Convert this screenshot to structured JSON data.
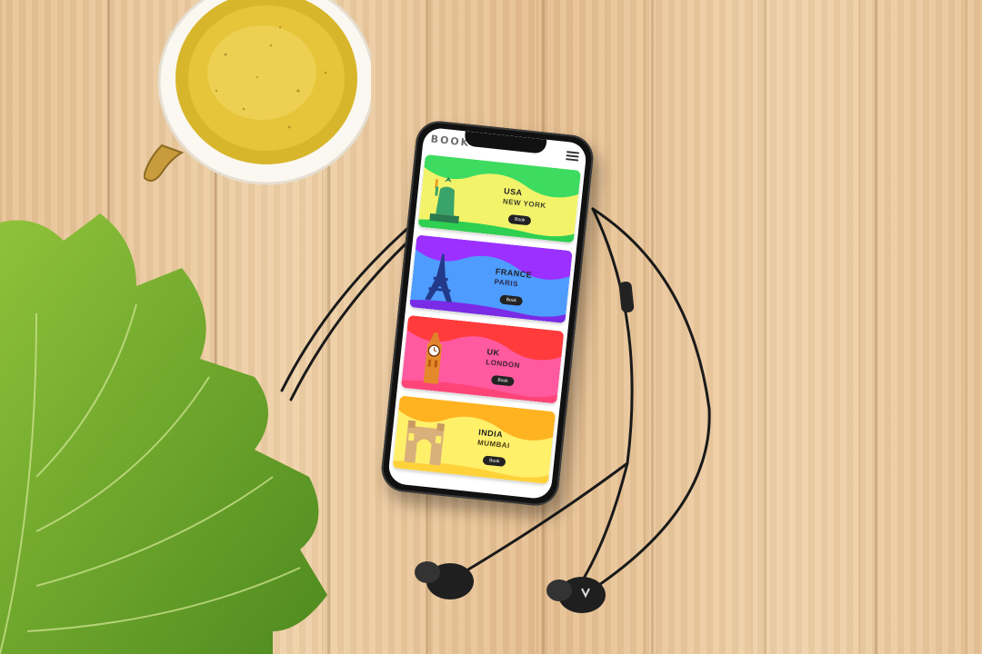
{
  "app": {
    "logo": "BOOK",
    "menu_icon": "hamburger-menu-icon"
  },
  "destinations": [
    {
      "country": "USA",
      "city": "NEW YORK",
      "button": "Book",
      "landmark_icon": "statue-of-liberty-icon",
      "colors": {
        "from": "#f6f05a",
        "to": "#3ddc61",
        "city": "#3f3f2a"
      }
    },
    {
      "country": "FRANCE",
      "city": "PARIS",
      "button": "Book",
      "landmark_icon": "eiffel-tower-icon",
      "colors": {
        "from": "#4aa1ff",
        "to": "#a22cff",
        "city": "#2b2b4a"
      }
    },
    {
      "country": "UK",
      "city": "LONDON",
      "button": "Book",
      "landmark_icon": "big-ben-icon",
      "colors": {
        "from": "#ff4f9a",
        "to": "#ff3a3a",
        "city": "#3a1e2a"
      }
    },
    {
      "country": "INDIA",
      "city": "MUMBAI",
      "button": "Book",
      "landmark_icon": "gateway-of-india-icon",
      "colors": {
        "from": "#ffe85a",
        "to": "#ffb51f",
        "city": "#4a3a18"
      }
    }
  ]
}
